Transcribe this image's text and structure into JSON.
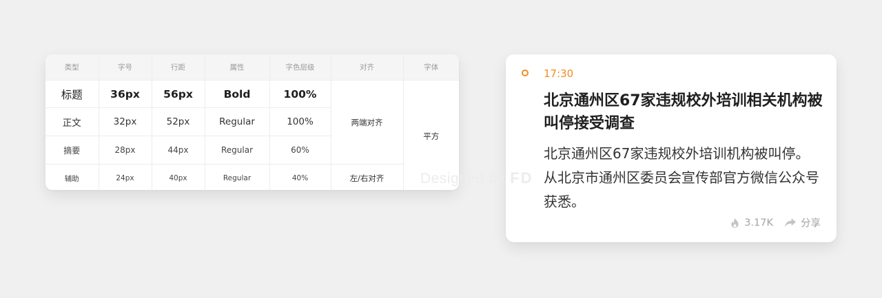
{
  "spec_table": {
    "headers": [
      "类型",
      "字号",
      "行距",
      "属性",
      "字色层级",
      "对齐",
      "字体"
    ],
    "rows": [
      [
        "标题",
        "36px",
        "56px",
        "Bold",
        "100%"
      ],
      [
        "正文",
        "32px",
        "52px",
        "Regular",
        "100%"
      ],
      [
        "摘要",
        "28px",
        "44px",
        "Regular",
        "60%"
      ],
      [
        "辅助",
        "24px",
        "40px",
        "Regular",
        "40%"
      ]
    ],
    "align_main": "两端对齐",
    "align_aux": "左/右对齐",
    "font_family_label": "平方"
  },
  "watermark": {
    "text": "Designed by",
    "logo": "FD"
  },
  "news_card": {
    "time": "17:30",
    "title": "北京通州区67家违规校外培训相关机构被叫停接受调查",
    "summary": "北京通州区67家违规校外培训机构被叫停。从北京市通州区委员会宣传部官方微信公众号获悉。",
    "hot_count": "3.17K",
    "share_label": "分享",
    "icons": {
      "time": "circle-dot-icon",
      "hot": "flame-icon",
      "share": "share-arrow-icon"
    },
    "colors": {
      "accent": "#f08c1e",
      "muted": "#a3a3a3"
    }
  }
}
